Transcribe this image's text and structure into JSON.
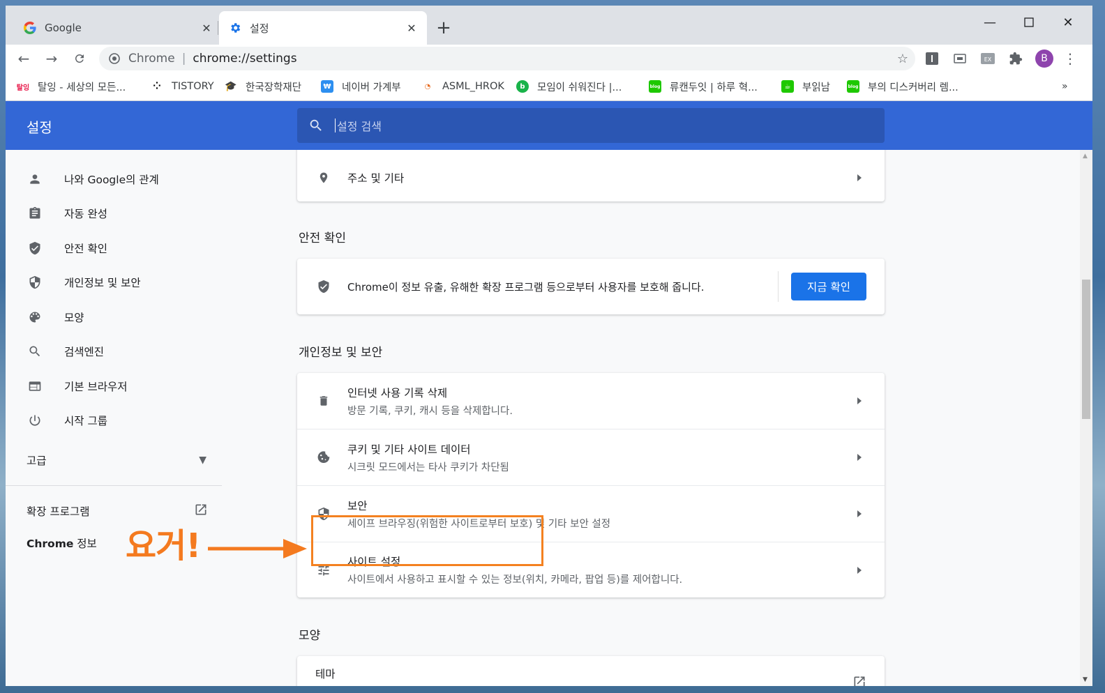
{
  "tabs": [
    {
      "title": "Google",
      "icon": "google-g-icon"
    },
    {
      "title": "설정",
      "icon": "gear-icon"
    }
  ],
  "toolbar": {
    "site_label": "Chrome",
    "separator": "|",
    "url": "chrome://settings",
    "avatar_letter": "B"
  },
  "bookmarks": [
    {
      "label": "탈잉 - 세상의 모든...",
      "icon": "taling-icon",
      "color": "#e8194a"
    },
    {
      "label": "TISTORY",
      "icon": "tistory-icon",
      "color": "#000000"
    },
    {
      "label": "한국장학재단",
      "icon": "scholarship-icon",
      "color": "#1c4b9c"
    },
    {
      "label": "네이버 가계부",
      "icon": "naver-ledger-icon",
      "color": "#2d8ff0"
    },
    {
      "label": "ASML_HROK",
      "icon": "asml-icon",
      "color": "#e86b1f"
    },
    {
      "label": "모임이 쉬워진다 |...",
      "icon": "meetup-icon",
      "color": "#19b34a"
    },
    {
      "label": "류캔두잇 | 하루 혁...",
      "icon": "blog-icon",
      "color": "#1ec800"
    },
    {
      "label": "부읽남",
      "icon": "coffee-icon",
      "color": "#1ec800"
    },
    {
      "label": "부의 디스커버리 렘...",
      "icon": "blog-icon",
      "color": "#1ec800"
    }
  ],
  "header": {
    "title": "설정",
    "search_placeholder": "설정 검색"
  },
  "sidebar": {
    "items": [
      {
        "label": "나와 Google의 관계",
        "icon": "person-icon"
      },
      {
        "label": "자동 완성",
        "icon": "clipboard-icon"
      },
      {
        "label": "안전 확인",
        "icon": "shield-check-icon"
      },
      {
        "label": "개인정보 및 보안",
        "icon": "shield-icon"
      },
      {
        "label": "모양",
        "icon": "palette-icon"
      },
      {
        "label": "검색엔진",
        "icon": "search-icon"
      },
      {
        "label": "기본 브라우저",
        "icon": "browser-icon"
      },
      {
        "label": "시작 그룹",
        "icon": "power-icon"
      }
    ],
    "advanced": "고급",
    "extensions": "확장 프로그램",
    "about_bold": "Chrome",
    "about_rest": " 정보"
  },
  "main": {
    "address_row": "주소 및 기타",
    "safety_section": "안전 확인",
    "safety_text": "Chrome이 정보 유출, 유해한 확장 프로그램 등으로부터 사용자를 보호해 줍니다.",
    "safety_button": "지금 확인",
    "privacy_section": "개인정보 및 보안",
    "privacy_rows": [
      {
        "title": "인터넷 사용 기록 삭제",
        "subtitle": "방문 기록, 쿠키, 캐시 등을 삭제합니다.",
        "icon": "trash-icon"
      },
      {
        "title": "쿠키 및 기타 사이트 데이터",
        "subtitle": "시크릿 모드에서는 타사 쿠키가 차단됨",
        "icon": "cookie-icon"
      },
      {
        "title": "보안",
        "subtitle": "세이프 브라우징(위험한 사이트로부터 보호) 및 기타 보안 설정",
        "icon": "shield-icon"
      },
      {
        "title": "사이트 설정",
        "subtitle": "사이트에서 사용하고 표시할 수 있는 정보(위치, 카메라, 팝업 등)를 제어합니다.",
        "icon": "tune-icon"
      }
    ],
    "appearance_section": "모양",
    "theme_row": "테마"
  },
  "annotation": {
    "text": "요거!",
    "color": "#f47a1f"
  },
  "colors": {
    "header_blue": "#3367d6",
    "button_blue": "#1a73e8",
    "highlight_orange": "#f48120"
  }
}
